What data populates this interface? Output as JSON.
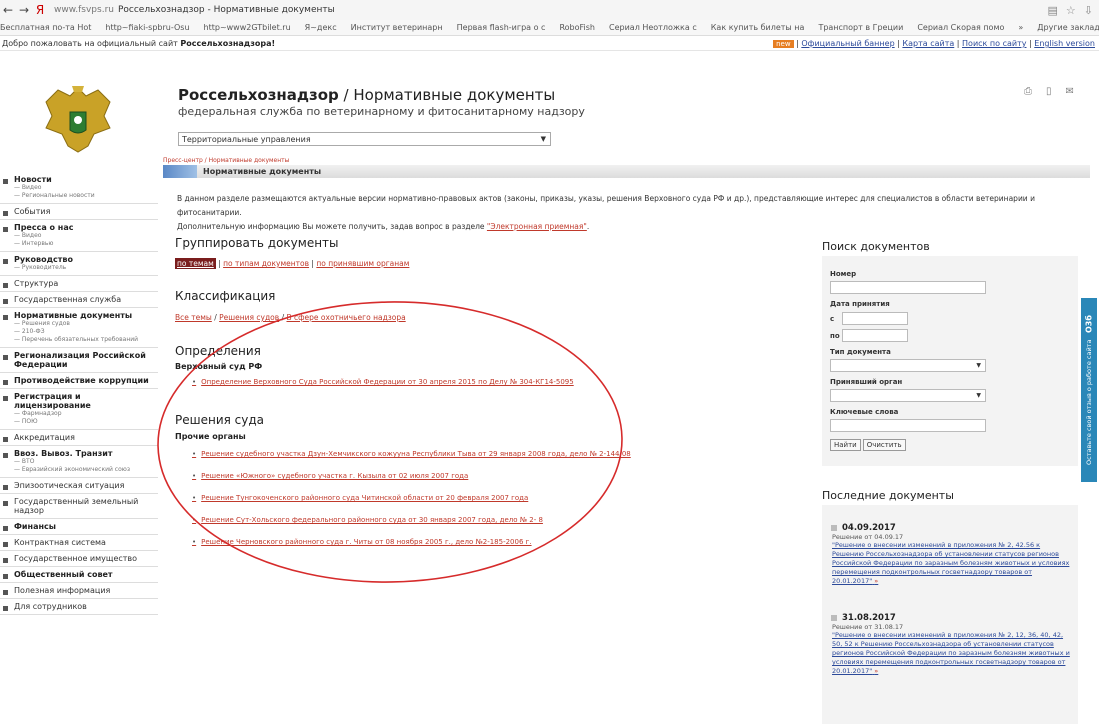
{
  "browser": {
    "url": "www.fsvps.ru",
    "tab_title": "Россельхознадзор - Нормативные документы",
    "back": "←",
    "forward": "→",
    "yandex": "Я",
    "bookmarks": [
      "Бесплатная по-та Hot",
      "http~fiaki-spbru-Osu",
      "http~www2GTbilet.ru",
      "Я~декс",
      "Институт ветеринарн",
      "Первая flash-игра о с",
      "RoboFish",
      "Сериал Неотложка с",
      "Как купить билеты на",
      "Транспорт в Греции",
      "Сериал Скорая помо",
      "»"
    ],
    "other_bookmarks": "Другие закладки"
  },
  "welcome": {
    "text": "Добро пожаловать на официальный сайт",
    "site": "Россельхознадзора!",
    "badge": "new",
    "links": [
      "Официальный баннер",
      "Карта сайта",
      "Поиск по сайту",
      "English version"
    ]
  },
  "header": {
    "title_bold": "Россельхознадзор",
    "title_rest": " / Нормативные документы",
    "subtitle": "федеральная служба по ветеринарному и фитосанитарному надзору",
    "region_select": "Территориальные управления",
    "breadcrumb": "Пресс-центр / Нормативные документы",
    "section": "Нормативные документы"
  },
  "sidebar": [
    {
      "label": "Новости",
      "bold": true,
      "subs": [
        "— Видео",
        "— Региональные новости"
      ]
    },
    {
      "label": "События",
      "bold": false,
      "subs": []
    },
    {
      "label": "Пресса о нас",
      "bold": true,
      "subs": [
        "— Видео",
        "— Интервью"
      ]
    },
    {
      "label": "Руководство",
      "bold": true,
      "subs": [
        "— Руководитель"
      ]
    },
    {
      "label": "Структура",
      "bold": false,
      "subs": []
    },
    {
      "label": "Государственная служба",
      "bold": false,
      "subs": []
    },
    {
      "label": "Нормативные документы",
      "bold": true,
      "subs": [
        "— Решения судов",
        "— 210-ФЗ",
        "— Перечень обязательных требований"
      ]
    },
    {
      "label": "Регионализация Российской Федерации",
      "bold": true,
      "subs": []
    },
    {
      "label": "Противодействие коррупции",
      "bold": true,
      "subs": []
    },
    {
      "label": "Регистрация и лицензирование",
      "bold": true,
      "subs": [
        "— Фармнадзор",
        "— ПОЮ"
      ]
    },
    {
      "label": "Аккредитация",
      "bold": false,
      "subs": []
    },
    {
      "label": "Ввоз. Вывоз. Транзит",
      "bold": true,
      "subs": [
        "— ВТО",
        "— Евразийский экономический союз"
      ]
    },
    {
      "label": "Эпизоотическая ситуация",
      "bold": false,
      "subs": []
    },
    {
      "label": "Государственный земельный надзор",
      "bold": false,
      "subs": []
    },
    {
      "label": "Финансы",
      "bold": true,
      "subs": []
    },
    {
      "label": "Контрактная система",
      "bold": false,
      "subs": []
    },
    {
      "label": "Государственное имущество",
      "bold": false,
      "subs": []
    },
    {
      "label": "Общественный совет",
      "bold": true,
      "subs": []
    },
    {
      "label": "Полезная информация",
      "bold": false,
      "subs": []
    },
    {
      "label": "Для сотрудников",
      "bold": false,
      "subs": []
    }
  ],
  "intro": {
    "line1": "В данном разделе размещаются актуальные версии нормативно-правовых актов (законы, приказы, указы, решения Верховного суда РФ и др.), представляющие интерес для специалистов в области ветеринарии и фитосанитарии.",
    "line2": "Дополнительную информацию Вы можете получить, задав вопрос в разделе ",
    "link": "\"Электронная приемная\"",
    "line2_end": "."
  },
  "group": {
    "heading": "Группировать документы",
    "active": "по темам",
    "others": [
      "по типам документов",
      "по принявшим органам"
    ]
  },
  "classification": {
    "heading": "Классификация",
    "crumbs": [
      "Все темы",
      "Решения судов",
      "В сфере охотничьего надзора"
    ]
  },
  "definitions": {
    "heading": "Определения",
    "org": "Верховный суд РФ",
    "items": [
      "Определение Верховного Суда Российской Федерации от 30 апреля 2015 по Делу № 304-КГ14-5095"
    ]
  },
  "court": {
    "heading": "Решения суда",
    "org": "Прочие органы",
    "items": [
      "Решение судебного участка Дзун-Хемчикского кожууна Республики Тыва от 29 января 2008 года, дело № 2-144/08",
      "Решение «Южного» судебного участка г. Кызыла от 02 июля 2007 года",
      "Решение Тунгокоченского районного суда Читинской области от 20 февраля 2007 года",
      "Решение Сут-Хольского федерального районного суда от 30 января 2007 года, дело № 2- 8",
      "Решение Черновского районного суда г. Читы от 08 ноября 2005 г., дело №2-185-2006 г."
    ]
  },
  "search": {
    "title": "Поиск документов",
    "number": "Номер",
    "date": "Дата принятия",
    "from": "с",
    "to": "по",
    "type": "Тип документа",
    "organ": "Принявший орган",
    "keywords": "Ключевые слова",
    "find": "Найти",
    "clear": "Очистить"
  },
  "feedback": "Оставьте свой отзыв о работе сайта",
  "feedback_badge": "О3б",
  "latest": {
    "title": "Последние документы",
    "items": [
      {
        "date": "04.09.2017",
        "rel": "Решение от 04.09.17",
        "text": "\"Решение о внесении изменений в приложения № 2, 42.56 к Решению Россельхознадзора об установлении статусов регионов Российской Федерации по заразным болезням животных и условиях перемещения подконтрольных госветнадзору товаров от 20.01.2017\"",
        "arrow": "»"
      },
      {
        "date": "31.08.2017",
        "rel": "Решение от 31.08.17",
        "text": "\"Решение о внесении изменений в приложения № 2, 12, 36, 40, 42, 50, 52 к Решению Россельхознадзора об установлении статусов регионов Российской Федерации по заразным болезням животных и условиях перемещения подконтрольных госветнадзору товаров от 20.01.2017\"",
        "arrow": "»"
      }
    ]
  },
  "colors": {
    "accent": "#c0392b",
    "active_tab": "#7a1d1d",
    "annotation": "#d62b2b",
    "feedback": "#2a87b8"
  }
}
